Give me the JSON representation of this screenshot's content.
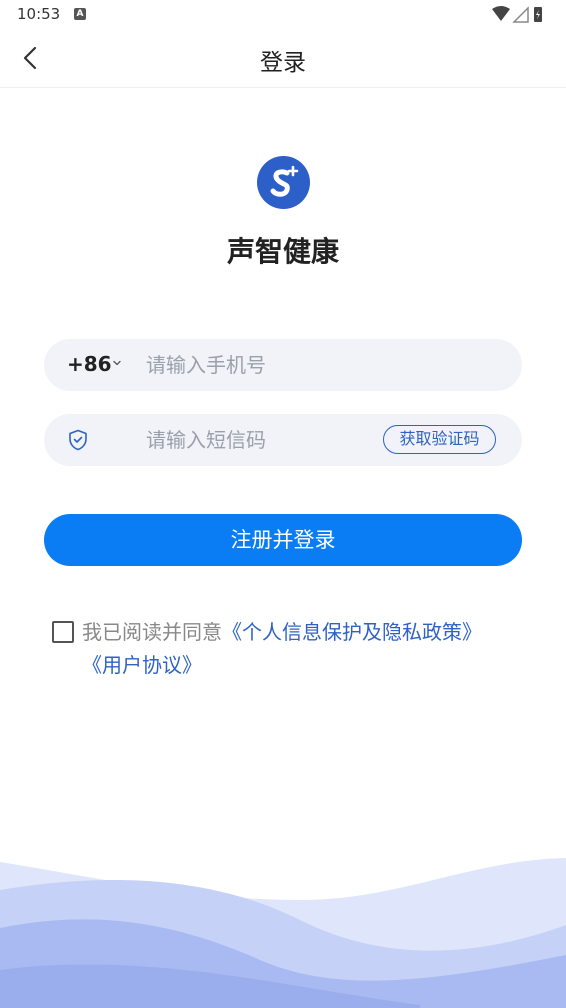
{
  "status_bar": {
    "time": "10:53",
    "notification_icon": "A"
  },
  "nav": {
    "title": "登录"
  },
  "app": {
    "name": "声智健康",
    "logo_icon": "logo-s-plus-icon"
  },
  "phone": {
    "country_code": "+86",
    "placeholder": "请输入手机号"
  },
  "sms": {
    "placeholder": "请输入短信码",
    "get_code_label": "获取验证码"
  },
  "login_button": {
    "label": "注册并登录"
  },
  "agreement": {
    "prefix": "我已阅读并同意",
    "privacy_link": "《个人信息保护及隐私政策》",
    "user_agreement_link": "《用户协议》"
  },
  "colors": {
    "primary": "#0A7CF4",
    "link": "#2F62C5",
    "input_bg": "#F1F3F8",
    "logo_bg": "#2D5FC9"
  }
}
